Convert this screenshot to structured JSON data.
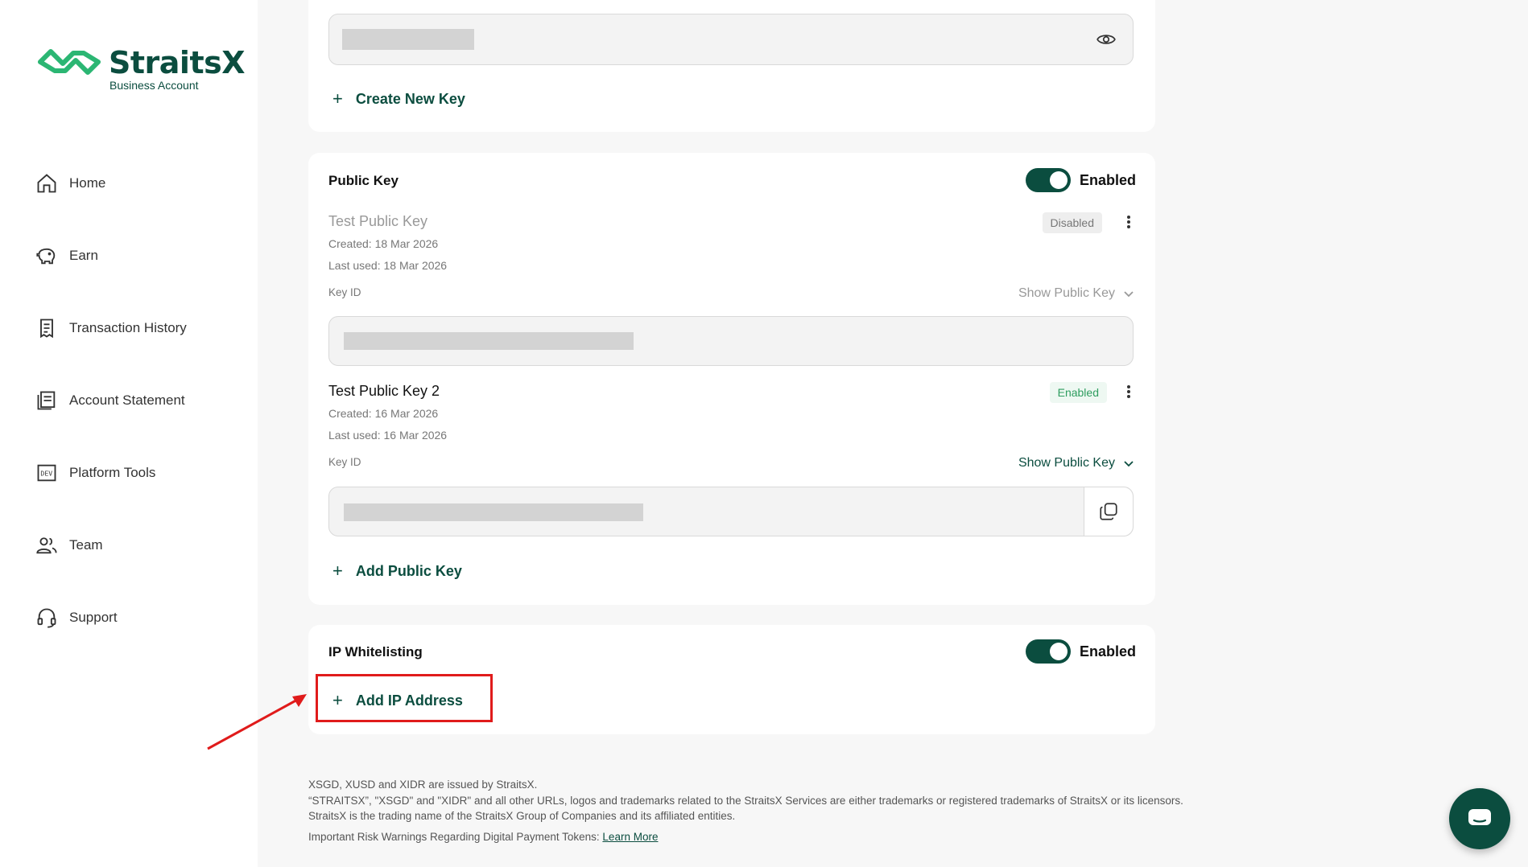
{
  "brand": {
    "name": "StraitsX",
    "subtitle": "Business Account",
    "color": "#0b4d3f",
    "accent": "#2bb673"
  },
  "sidebar": {
    "items": [
      {
        "label": "Home",
        "icon": "home-icon"
      },
      {
        "label": "Earn",
        "icon": "piggy-bank-icon"
      },
      {
        "label": "Transaction History",
        "icon": "receipt-icon"
      },
      {
        "label": "Account Statement",
        "icon": "statement-icon"
      },
      {
        "label": "Platform Tools",
        "icon": "dev-icon"
      },
      {
        "label": "Team",
        "icon": "team-icon"
      },
      {
        "label": "Support",
        "icon": "headset-icon"
      }
    ]
  },
  "api_key": {
    "create_label": "Create New Key",
    "eye_icon": "eye-icon"
  },
  "public_key": {
    "title": "Public Key",
    "toggle_label": "Enabled",
    "keys": [
      {
        "name": "Test Public Key",
        "created": "Created: 18 Mar 2026",
        "last_used": "Last used: 18 Mar 2026",
        "status": "Disabled",
        "key_id_label": "Key ID",
        "show_label": "Show Public Key"
      },
      {
        "name": "Test Public Key 2",
        "created": "Created: 16 Mar 2026",
        "last_used": "Last used: 16 Mar 2026",
        "status": "Enabled",
        "key_id_label": "Key ID",
        "show_label": "Show Public Key"
      }
    ],
    "add_label": "Add Public Key"
  },
  "ip_whitelisting": {
    "title": "IP Whitelisting",
    "toggle_label": "Enabled",
    "add_label": "Add IP Address"
  },
  "footer": {
    "line1": "XSGD, XUSD and XIDR are issued by StraitsX.",
    "line2": "“STRAITSX”, \"XSGD\" and \"XIDR\" and all other URLs, logos and trademarks related to the StraitsX Services are either trademarks or registered trademarks of StraitsX or its licensors.",
    "line3": "StraitsX is the trading name of the StraitsX Group of Companies and its affiliated entities.",
    "line4": "Important Risk Warnings Regarding Digital Payment Tokens: ",
    "learn_more": "Learn More"
  }
}
